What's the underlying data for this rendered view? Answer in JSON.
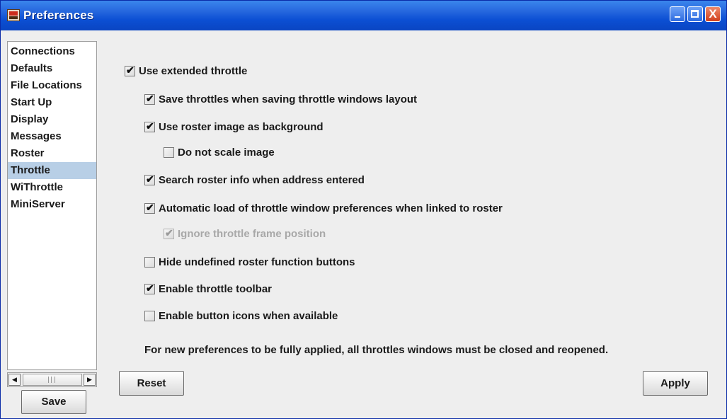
{
  "window": {
    "title": "Preferences",
    "controls": {
      "minimize": "_",
      "maximize": "□",
      "close": "X"
    }
  },
  "sidebar": {
    "items": [
      {
        "label": "Connections",
        "selected": false
      },
      {
        "label": "Defaults",
        "selected": false
      },
      {
        "label": "File Locations",
        "selected": false
      },
      {
        "label": "Start Up",
        "selected": false
      },
      {
        "label": "Display",
        "selected": false
      },
      {
        "label": "Messages",
        "selected": false
      },
      {
        "label": "Roster",
        "selected": false
      },
      {
        "label": "Throttle",
        "selected": true
      },
      {
        "label": "WiThrottle",
        "selected": false
      },
      {
        "label": "MiniServer",
        "selected": false
      }
    ],
    "scroll": {
      "left_arrow": "◀",
      "right_arrow": "▶"
    },
    "save_label": "Save"
  },
  "throttle_prefs": {
    "options": [
      {
        "label": "Use extended throttle",
        "checked": true,
        "enabled": true
      },
      {
        "label": "Save throttles when saving throttle windows layout",
        "checked": true,
        "enabled": true
      },
      {
        "label": "Use roster image as background",
        "checked": true,
        "enabled": true
      },
      {
        "label": "Do not scale image",
        "checked": false,
        "enabled": true
      },
      {
        "label": "Search roster info when address entered",
        "checked": true,
        "enabled": true
      },
      {
        "label": "Automatic load of throttle window preferences when linked to roster",
        "checked": true,
        "enabled": true
      },
      {
        "label": "Ignore throttle frame position",
        "checked": true,
        "enabled": false
      },
      {
        "label": "Hide undefined roster function buttons",
        "checked": false,
        "enabled": true
      },
      {
        "label": "Enable throttle toolbar",
        "checked": true,
        "enabled": true
      },
      {
        "label": "Enable button icons when available",
        "checked": false,
        "enabled": true
      }
    ],
    "note": "For new preferences to be fully applied, all throttles windows must be closed and reopened.",
    "reset_label": "Reset",
    "apply_label": "Apply"
  },
  "icons": {
    "app": "app-window-icon",
    "checkmark": "✔"
  }
}
